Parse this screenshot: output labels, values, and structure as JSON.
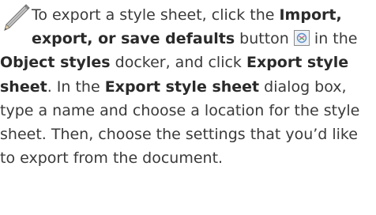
{
  "note": {
    "icon": "pencil-icon",
    "part1": "To export a style sheet, click the ",
    "bold_import": "Import, export, or save defaults",
    "part2": " button ",
    "part3": " in the ",
    "bold_object_styles": "Object styles",
    "part4": " docker, and click ",
    "bold_export_style_sheet": "Export style sheet",
    "part5": ". In the ",
    "bold_export_dialog": "Export style sheet",
    "part6": " dialog box, type a name and choose a location for the style sheet. Then, choose the settings that you’d like to export from the document."
  },
  "button_icon": "import-export-icon"
}
